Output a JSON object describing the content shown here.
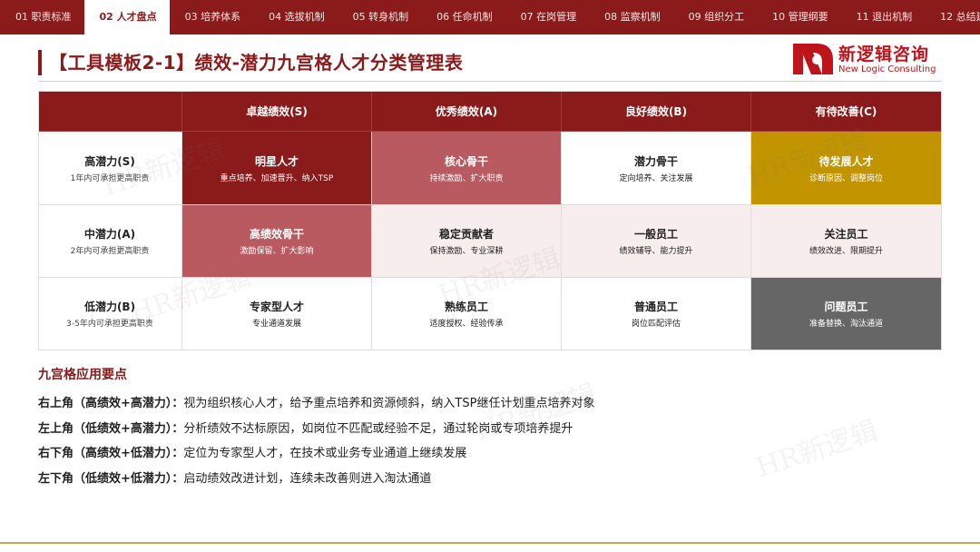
{
  "nav": {
    "tabs": [
      {
        "label": "01 职责标准",
        "active": false
      },
      {
        "label": "02 人才盘点",
        "active": true
      },
      {
        "label": "03 培养体系",
        "active": false
      },
      {
        "label": "04 选拔机制",
        "active": false
      },
      {
        "label": "05 转身机制",
        "active": false
      },
      {
        "label": "06 任命机制",
        "active": false
      },
      {
        "label": "07 在岗管理",
        "active": false
      },
      {
        "label": "08 监察机制",
        "active": false
      },
      {
        "label": "09 组织分工",
        "active": false
      },
      {
        "label": "10 管理纲要",
        "active": false
      },
      {
        "label": "11 退出机制",
        "active": false
      },
      {
        "label": "12 总结建议",
        "active": false
      }
    ]
  },
  "header": {
    "title": "【工具模板2-1】绩效-潜力九宫格人才分类管理表",
    "brand_cn": "新逻辑咨询",
    "brand_en": "New Logic Consulting"
  },
  "grid": {
    "col_headers": [
      "卓越绩效(S)",
      "优秀绩效(A)",
      "良好绩效(B)",
      "有待改善(C)"
    ],
    "rows": [
      {
        "label": "高潜力(S)",
        "sub": "1年内可承担更高职责",
        "cells": [
          {
            "title": "明星人才",
            "desc": "重点培养、加速晋升、纳入TSP",
            "tone": "dark"
          },
          {
            "title": "核心骨干",
            "desc": "持续激励、扩大职责",
            "tone": "mid"
          },
          {
            "title": "潜力骨干",
            "desc": "定向培养、关注发展",
            "tone": "white"
          },
          {
            "title": "待发展人才",
            "desc": "诊断原因、调整岗位",
            "tone": "gold"
          }
        ]
      },
      {
        "label": "中潜力(A)",
        "sub": "2年内可承担更高职责",
        "cells": [
          {
            "title": "高绩效骨干",
            "desc": "激励保留、扩大影响",
            "tone": "mid"
          },
          {
            "title": "稳定贡献者",
            "desc": "保持激励、专业深耕",
            "tone": "light"
          },
          {
            "title": "一般员工",
            "desc": "绩效辅导、能力提升",
            "tone": "light"
          },
          {
            "title": "关注员工",
            "desc": "绩效改进、限期提升",
            "tone": "light"
          }
        ]
      },
      {
        "label": "低潜力(B)",
        "sub": "3-5年内可承担更高职责",
        "cells": [
          {
            "title": "专家型人才",
            "desc": "专业通道发展",
            "tone": "white"
          },
          {
            "title": "熟练员工",
            "desc": "适度授权、经验传承",
            "tone": "white"
          },
          {
            "title": "普通员工",
            "desc": "岗位匹配评估",
            "tone": "white"
          },
          {
            "title": "问题员工",
            "desc": "准备替换、淘汰通道",
            "tone": "gray"
          }
        ]
      }
    ]
  },
  "notes": {
    "title": "九宫格应用要点",
    "items": [
      {
        "label": "右上角（高绩效+高潜力）：",
        "text": "视为组织核心人才，给予重点培养和资源倾斜，纳入TSP继任计划重点培养对象"
      },
      {
        "label": "左上角（低绩效+高潜力）：",
        "text": "分析绩效不达标原因，如岗位不匹配或经验不足，通过轮岗或专项培养提升"
      },
      {
        "label": "右下角（高绩效+低潜力）：",
        "text": "定位为专家型人才，在技术或业务专业通道上继续发展"
      },
      {
        "label": "左下角（低绩效+低潜力）：",
        "text": "启动绩效改进计划，连续未改善则进入淘汰通道"
      }
    ]
  },
  "watermark": "HR新逻辑",
  "colors": {
    "brand_dark": "#8b1a1a",
    "brand_mid": "#b85a60",
    "brand_light": "#f7eded",
    "gold": "#c19400",
    "gray": "#666666",
    "logo_red": "#c0141c"
  }
}
